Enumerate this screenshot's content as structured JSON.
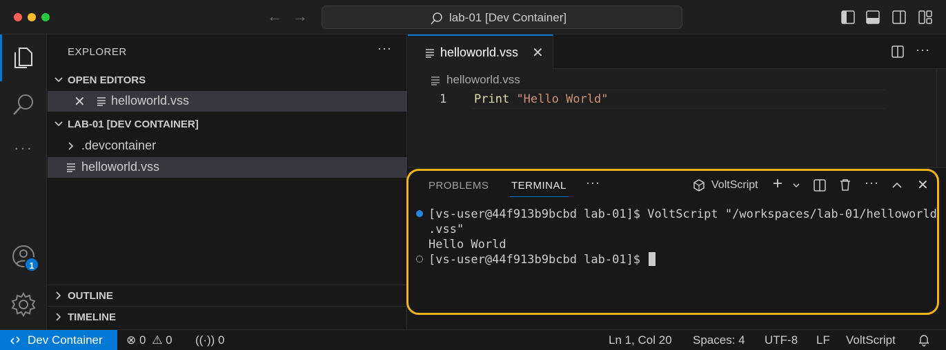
{
  "window": {
    "title": "lab-01 [Dev Container]"
  },
  "activity_bar": {
    "accounts_badge": "1"
  },
  "sidebar": {
    "title": "EXPLORER",
    "more": "···",
    "open_editors": {
      "header": "OPEN EDITORS",
      "items": [
        {
          "label": "helloworld.vss"
        }
      ]
    },
    "workspace": {
      "header": "LAB-01 [DEV CONTAINER]",
      "items": [
        {
          "label": ".devcontainer"
        },
        {
          "label": "helloworld.vss"
        }
      ]
    },
    "outline_header": "OUTLINE",
    "timeline_header": "TIMELINE"
  },
  "editor": {
    "tab_label": "helloworld.vss",
    "breadcrumb": "helloworld.vss",
    "line_number": "1",
    "code_keyword": "Print",
    "code_string": "\"Hello World\""
  },
  "panel": {
    "tabs": [
      "PROBLEMS",
      "TERMINAL"
    ],
    "active_tab": "TERMINAL",
    "more": "···",
    "terminal_name": "VoltScript",
    "lines": [
      "[vs-user@44f913b9bcbd lab-01]$ VoltScript \"/workspaces/lab-01/helloworld",
      ".vss\"",
      "Hello World",
      "[vs-user@44f913b9bcbd lab-01]$ "
    ]
  },
  "status_bar": {
    "remote": "Dev Container",
    "errors": "0",
    "warnings": "0",
    "ports": "0",
    "position": "Ln 1, Col 20",
    "indent": "Spaces: 4",
    "encoding": "UTF-8",
    "eol": "LF",
    "language": "VoltScript"
  },
  "colors": {
    "accent": "#0078d4",
    "highlight": "#f0b41c"
  }
}
